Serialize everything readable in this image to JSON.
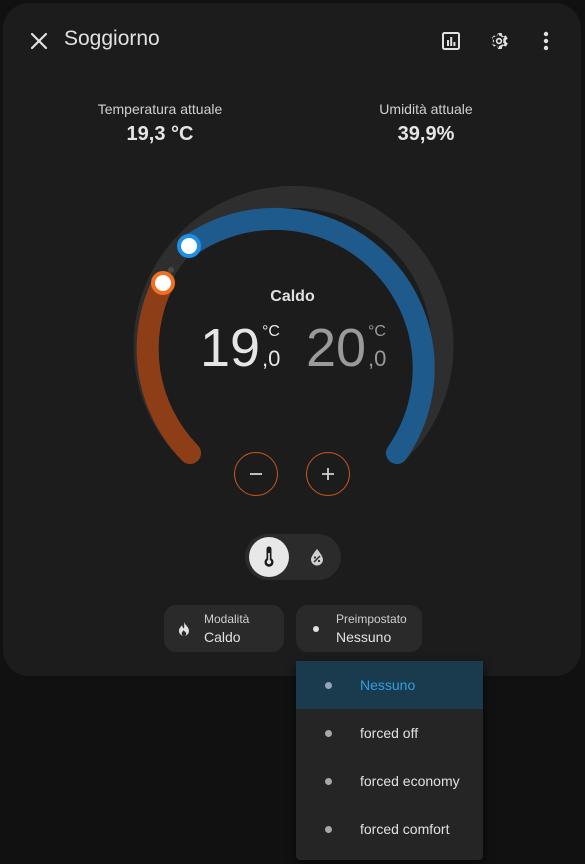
{
  "header": {
    "title": "Soggiorno",
    "icons": [
      "close-icon",
      "history-chart-icon",
      "settings-gear-icon",
      "more-vertical-icon"
    ]
  },
  "stats": {
    "current_temp_label": "Temperatura attuale",
    "current_temp_value": "19,3 °C",
    "current_humidity_label": "Umidità attuale",
    "current_humidity_value": "39,9%"
  },
  "thermostat": {
    "mode_label": "Caldo",
    "low": {
      "int": "19",
      "dec": ",0",
      "unit": "°C"
    },
    "high": {
      "int": "20",
      "dec": ",0",
      "unit": "°C"
    },
    "low_setpoint": 19,
    "high_setpoint": 20,
    "colors": {
      "heat": "#c8591f",
      "cool": "#1e6fb0",
      "track": "#2e2e2e"
    }
  },
  "view_toggle": {
    "options": [
      "thermometer-icon",
      "humidity-icon"
    ],
    "selected": 0
  },
  "chips": {
    "mode": {
      "label": "Modalità",
      "value": "Caldo",
      "icon": "flame-icon"
    },
    "preset": {
      "label": "Preimpostato",
      "value": "Nessuno",
      "icon": "dot-icon"
    }
  },
  "preset_menu": {
    "items": [
      "Nessuno",
      "forced off",
      "forced economy",
      "forced comfort"
    ],
    "selected": 0
  }
}
